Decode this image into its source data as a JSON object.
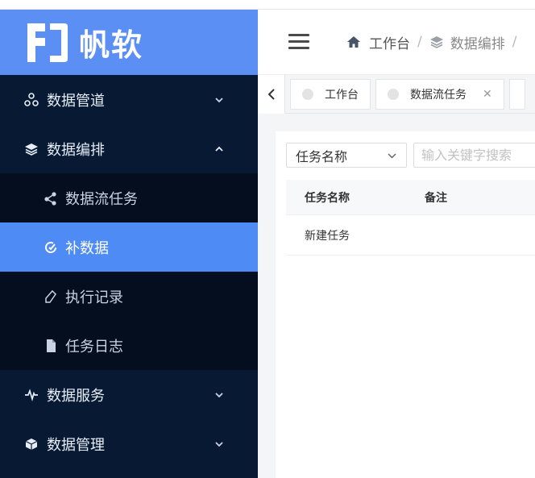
{
  "brand": {
    "name": "帆软",
    "bg": "#5b8ff3"
  },
  "sidebar": {
    "groups": [
      {
        "label": "数据管道",
        "icon": "pipeline-icon",
        "expanded": false
      },
      {
        "label": "数据编排",
        "icon": "layers-icon",
        "expanded": true
      },
      {
        "label": "数据服务",
        "icon": "pulse-icon",
        "expanded": false
      },
      {
        "label": "数据管理",
        "icon": "cube-icon",
        "expanded": false
      }
    ],
    "sub_items": [
      {
        "label": "数据流任务",
        "icon": "share-nodes-icon",
        "active": false
      },
      {
        "label": "补数据",
        "icon": "refresh-check-icon",
        "active": true
      },
      {
        "label": "执行记录",
        "icon": "tag-icon",
        "active": false
      },
      {
        "label": "任务日志",
        "icon": "file-icon",
        "active": false
      }
    ],
    "active_color": "#4f8bf5"
  },
  "header": {
    "breadcrumb": [
      "工作台",
      "数据编排"
    ]
  },
  "tabs": [
    {
      "label": "工作台",
      "closable": false
    },
    {
      "label": "数据流任务",
      "closable": true
    }
  ],
  "filters": {
    "field_select": "任务名称",
    "search_placeholder": "输入关键字搜索"
  },
  "table": {
    "columns": [
      "任务名称",
      "备注"
    ],
    "rows": [
      [
        "新建任务",
        ""
      ]
    ]
  }
}
